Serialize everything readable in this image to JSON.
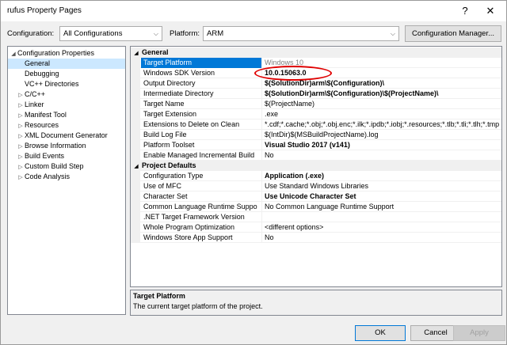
{
  "window": {
    "title": "rufus Property Pages",
    "help_glyph": "?",
    "close_glyph": "✕"
  },
  "topbar": {
    "configuration_label": "Configuration:",
    "configuration_value": "All Configurations",
    "platform_label": "Platform:",
    "platform_value": "ARM",
    "config_manager_label": "Configuration Manager..."
  },
  "tree": {
    "root": "Configuration Properties",
    "items": [
      {
        "label": "General",
        "expander": "",
        "selected": true
      },
      {
        "label": "Debugging",
        "expander": ""
      },
      {
        "label": "VC++ Directories",
        "expander": ""
      },
      {
        "label": "C/C++",
        "expander": "▷"
      },
      {
        "label": "Linker",
        "expander": "▷"
      },
      {
        "label": "Manifest Tool",
        "expander": "▷"
      },
      {
        "label": "Resources",
        "expander": "▷"
      },
      {
        "label": "XML Document Generator",
        "expander": "▷"
      },
      {
        "label": "Browse Information",
        "expander": "▷"
      },
      {
        "label": "Build Events",
        "expander": "▷"
      },
      {
        "label": "Custom Build Step",
        "expander": "▷"
      },
      {
        "label": "Code Analysis",
        "expander": "▷"
      }
    ]
  },
  "grid": {
    "sections": [
      {
        "title": "General",
        "rows": [
          {
            "name": "Target Platform",
            "value": "Windows 10",
            "style": "gray",
            "selected": true
          },
          {
            "name": "Windows SDK Version",
            "value": "10.0.15063.0",
            "style": "bold"
          },
          {
            "name": "Output Directory",
            "value": "$(SolutionDir)arm\\$(Configuration)\\",
            "style": "bold"
          },
          {
            "name": "Intermediate Directory",
            "value": "$(SolutionDir)arm\\$(Configuration)\\$(ProjectName)\\",
            "style": "bold"
          },
          {
            "name": "Target Name",
            "value": "$(ProjectName)",
            "style": ""
          },
          {
            "name": "Target Extension",
            "value": ".exe",
            "style": ""
          },
          {
            "name": "Extensions to Delete on Clean",
            "value": "*.cdf;*.cache;*.obj;*.obj.enc;*.ilk;*.ipdb;*.iobj;*.resources;*.tlb;*.tli;*.tlh;*.tmp",
            "style": ""
          },
          {
            "name": "Build Log File",
            "value": "$(IntDir)$(MSBuildProjectName).log",
            "style": ""
          },
          {
            "name": "Platform Toolset",
            "value": "Visual Studio 2017 (v141)",
            "style": "bold"
          },
          {
            "name": "Enable Managed Incremental Build",
            "value": "No",
            "style": ""
          }
        ]
      },
      {
        "title": "Project Defaults",
        "rows": [
          {
            "name": "Configuration Type",
            "value": "Application (.exe)",
            "style": "bold"
          },
          {
            "name": "Use of MFC",
            "value": "Use Standard Windows Libraries",
            "style": ""
          },
          {
            "name": "Character Set",
            "value": "Use Unicode Character Set",
            "style": "bold"
          },
          {
            "name": "Common Language Runtime Suppo",
            "value": "No Common Language Runtime Support",
            "style": ""
          },
          {
            "name": ".NET Target Framework Version",
            "value": "",
            "style": ""
          },
          {
            "name": "Whole Program Optimization",
            "value": "<different options>",
            "style": ""
          },
          {
            "name": "Windows Store App Support",
            "value": "No",
            "style": ""
          }
        ]
      }
    ]
  },
  "description": {
    "title": "Target Platform",
    "text": "The current target platform of the project."
  },
  "buttons": {
    "ok": "OK",
    "cancel": "Cancel",
    "apply": "Apply"
  },
  "colors": {
    "selection": "#0078d7",
    "annotation_circle": "#e00000"
  }
}
